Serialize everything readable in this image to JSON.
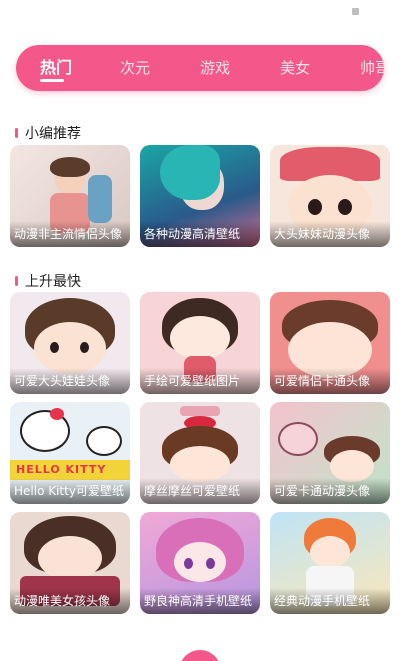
{
  "tabs": [
    "热门",
    "次元",
    "游戏",
    "美女",
    "帅哥"
  ],
  "active_tab": 0,
  "sections": {
    "featured": {
      "title": "小编推荐",
      "cards": [
        "动漫非主流情侣头像",
        "各种动漫高清壁纸",
        "大头妹妹动漫头像"
      ]
    },
    "rising": {
      "title": "上升最快",
      "cards": [
        "可爱大头娃娃头像",
        "手绘可爱壁纸图片",
        "可爱情侣卡通头像",
        "Hello Kitty可爱壁纸",
        "摩丝摩丝可爱壁纸",
        "可爱卡通动漫头像",
        "动漫唯美女孩头像",
        "野良神高清手机壁纸",
        "经典动漫手机壁纸"
      ]
    }
  },
  "colors": {
    "accent": "#f4588a"
  }
}
